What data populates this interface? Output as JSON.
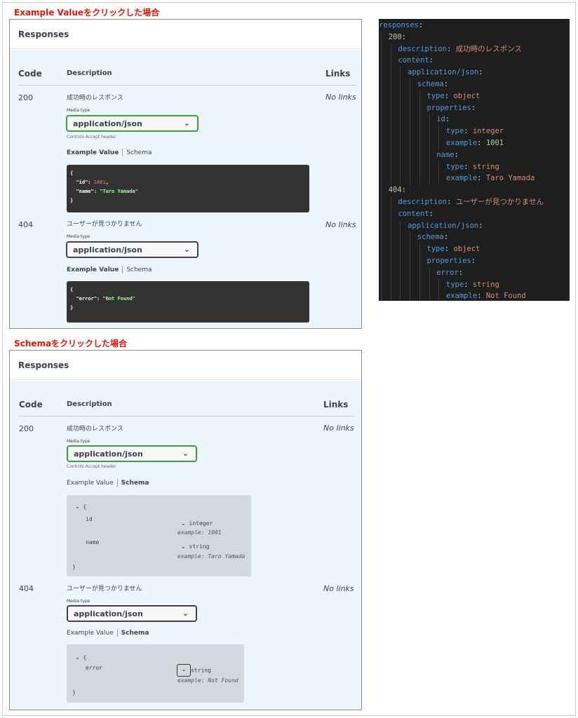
{
  "sections": {
    "example_title": "Example Valueをクリックした場合",
    "schema_title": "Schemaをクリックした場合"
  },
  "panel": {
    "title": "Responses",
    "col_code": "Code",
    "col_description": "Description",
    "col_links": "Links"
  },
  "responses": [
    {
      "code": "200",
      "description": "成功時のレスポンス",
      "links": "No links",
      "media_type_label": "Media type",
      "media_type": "application/json",
      "controls_note": "Controls Accept header.",
      "tab_example": "Example Value",
      "tab_schema": "Schema"
    },
    {
      "code": "404",
      "description": "ユーザーが見つかりません",
      "links": "No links",
      "media_type_label": "Media type",
      "media_type": "application/json",
      "tab_example": "Example Value",
      "tab_schema": "Schema"
    }
  ],
  "example_200": {
    "open": "{",
    "id_key": "\"id\"",
    "id_value": "1001",
    "name_key": "\"name\"",
    "name_value": "\"Taro Yamada\"",
    "close": "}"
  },
  "example_404": {
    "open": "{",
    "error_key": "\"error\"",
    "error_value": "\"Not Found\"",
    "close": "}"
  },
  "schema_200": {
    "open": "{",
    "field1": "id",
    "field1_type": "integer",
    "field1_example": "example: 1001",
    "field2": "name",
    "field2_type": "string",
    "field2_example": "example: Taro Yamada",
    "close": "}"
  },
  "schema_404": {
    "open": "{",
    "field1": "error",
    "field1_type": "string",
    "field1_example": "example: Not Found",
    "close": "}"
  },
  "yaml": [
    {
      "indent": 0,
      "key": "responses",
      "value": ""
    },
    {
      "indent": 1,
      "key": "200",
      "value": "",
      "num_key": true
    },
    {
      "indent": 2,
      "key": "description",
      "value": "成功時のレスポンス",
      "vtype": "s"
    },
    {
      "indent": 2,
      "key": "content",
      "value": ""
    },
    {
      "indent": 3,
      "key": "application/json",
      "value": ""
    },
    {
      "indent": 4,
      "key": "schema",
      "value": ""
    },
    {
      "indent": 5,
      "key": "type",
      "value": "object",
      "vtype": "s"
    },
    {
      "indent": 5,
      "key": "properties",
      "value": ""
    },
    {
      "indent": 6,
      "key": "id",
      "value": ""
    },
    {
      "indent": 7,
      "key": "type",
      "value": "integer",
      "vtype": "s"
    },
    {
      "indent": 7,
      "key": "example",
      "value": "1001",
      "vtype": "n"
    },
    {
      "indent": 6,
      "key": "name",
      "value": ""
    },
    {
      "indent": 7,
      "key": "type",
      "value": "string",
      "vtype": "s"
    },
    {
      "indent": 7,
      "key": "example",
      "value": "Taro Yamada",
      "vtype": "s"
    },
    {
      "indent": 1,
      "key": "404",
      "value": "",
      "num_key": true
    },
    {
      "indent": 2,
      "key": "description",
      "value": "ユーザーが見つかりません",
      "vtype": "s"
    },
    {
      "indent": 2,
      "key": "content",
      "value": ""
    },
    {
      "indent": 3,
      "key": "application/json",
      "value": ""
    },
    {
      "indent": 4,
      "key": "schema",
      "value": ""
    },
    {
      "indent": 5,
      "key": "type",
      "value": "object",
      "vtype": "s"
    },
    {
      "indent": 5,
      "key": "properties",
      "value": ""
    },
    {
      "indent": 6,
      "key": "error",
      "value": ""
    },
    {
      "indent": 7,
      "key": "type",
      "value": "string",
      "vtype": "s"
    },
    {
      "indent": 7,
      "key": "example",
      "value": "Not Found",
      "vtype": "s"
    }
  ],
  "icons": {
    "chevron": "chevron-down-icon"
  },
  "colors": {
    "title_red": "#e8160c",
    "active_select_border": "#3b9e3b",
    "panel_bg": "#eef6fd",
    "code_bg": "#333333",
    "yaml_bg": "#1e1e1e"
  }
}
